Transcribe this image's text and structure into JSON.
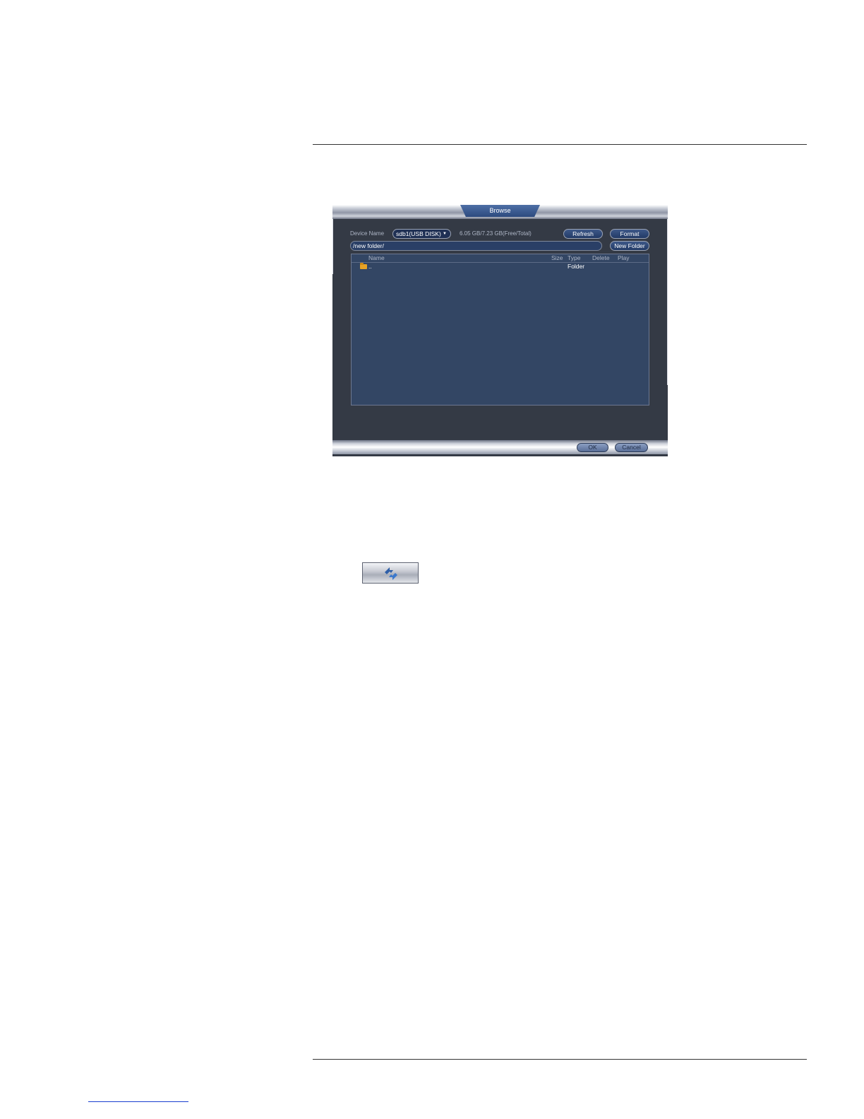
{
  "dialog": {
    "title": "Browse",
    "device_name_label": "Device Name",
    "device_select_value": "sdb1(USB DISK)",
    "capacity_text": "6.05 GB/7.23 GB(Free/Total)",
    "refresh_label": "Refresh",
    "format_label": "Format",
    "path_value": "/new folder/",
    "new_folder_label": "New Folder",
    "columns": {
      "name": "Name",
      "size": "Size",
      "type": "Type",
      "delete": "Delete",
      "play": "Play"
    },
    "rows": [
      {
        "name": "..",
        "size": "",
        "type": "Folder",
        "icon": "folder-icon"
      }
    ],
    "ok_label": "OK",
    "cancel_label": "Cancel"
  },
  "refresh_button": {
    "icon": "refresh-icon"
  }
}
